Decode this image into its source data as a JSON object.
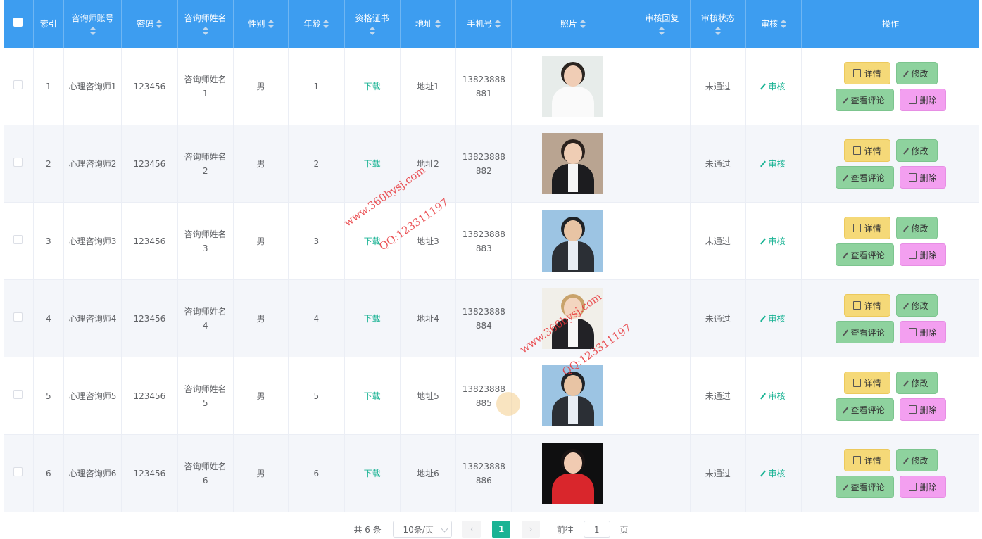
{
  "table": {
    "headers": [
      "索引",
      "咨询师账号",
      "密码",
      "咨询师姓名",
      "性别",
      "年龄",
      "资格证书",
      "地址",
      "手机号",
      "照片",
      "审核回复",
      "审核状态",
      "审核",
      "操作"
    ],
    "rows": [
      {
        "index": "1",
        "account": "心理咨询师1",
        "password": "123456",
        "name": "咨询师姓名1",
        "gender": "男",
        "age": "1",
        "cert": "下载",
        "address": "地址1",
        "phone": "13823888881",
        "reply": "",
        "status": "未通过",
        "audit": "审核"
      },
      {
        "index": "2",
        "account": "心理咨询师2",
        "password": "123456",
        "name": "咨询师姓名2",
        "gender": "男",
        "age": "2",
        "cert": "下载",
        "address": "地址2",
        "phone": "13823888882",
        "reply": "",
        "status": "未通过",
        "audit": "审核"
      },
      {
        "index": "3",
        "account": "心理咨询师3",
        "password": "123456",
        "name": "咨询师姓名3",
        "gender": "男",
        "age": "3",
        "cert": "下载",
        "address": "地址3",
        "phone": "13823888883",
        "reply": "",
        "status": "未通过",
        "audit": "审核"
      },
      {
        "index": "4",
        "account": "心理咨询师4",
        "password": "123456",
        "name": "咨询师姓名4",
        "gender": "男",
        "age": "4",
        "cert": "下载",
        "address": "地址4",
        "phone": "13823888884",
        "reply": "",
        "status": "未通过",
        "audit": "审核"
      },
      {
        "index": "5",
        "account": "心理咨询师5",
        "password": "123456",
        "name": "咨询师姓名5",
        "gender": "男",
        "age": "5",
        "cert": "下载",
        "address": "地址5",
        "phone": "13823888885",
        "reply": "",
        "status": "未通过",
        "audit": "审核"
      },
      {
        "index": "6",
        "account": "心理咨询师6",
        "password": "123456",
        "name": "咨询师姓名6",
        "gender": "男",
        "age": "6",
        "cert": "下载",
        "address": "地址6",
        "phone": "13823888886",
        "reply": "",
        "status": "未通过",
        "audit": "审核"
      }
    ],
    "actions": {
      "detail": "详情",
      "edit": "修改",
      "comments": "查看评论",
      "delete": "删除"
    }
  },
  "pagination": {
    "total": "共 6 条",
    "page_size": "10条/页",
    "current_page": "1",
    "goto_prefix": "前往",
    "goto_value": "1",
    "goto_suffix": "页"
  },
  "watermarks": [
    "www.360bysj.com",
    "QQ:123311197"
  ],
  "colors": {
    "header": "#3d9df0",
    "link": "#1ab394",
    "btn_detail": "#f5d978",
    "btn_edit": "#8ed29e",
    "btn_delete": "#f39ff0"
  }
}
